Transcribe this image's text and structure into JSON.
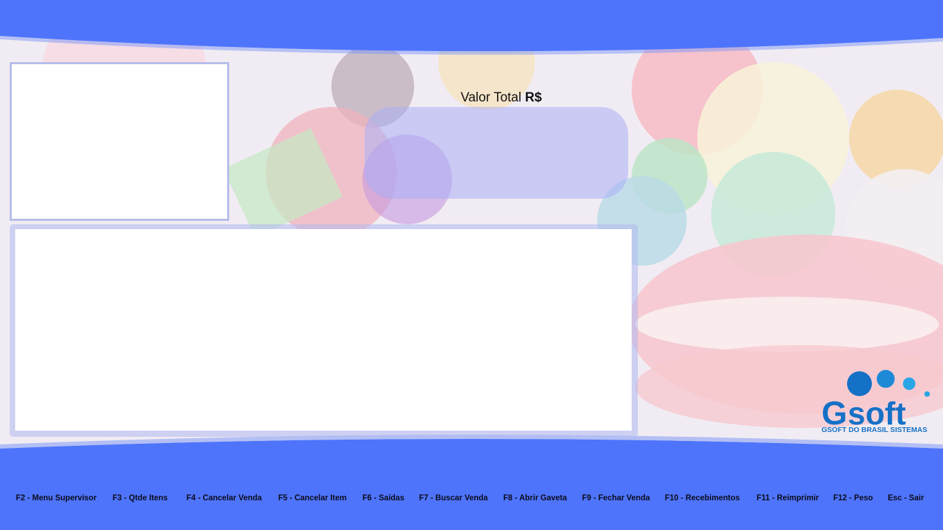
{
  "colors": {
    "band_blue": "#4e74fc",
    "panel_border": "#b6bde9",
    "logo_blue": "#1571c6"
  },
  "total": {
    "label": "Valor Total",
    "currency": "R$",
    "value": ""
  },
  "logo": {
    "letter_g": "G",
    "word": "soft",
    "subtitle": "GSOFT DO BRASIL SISTEMAS"
  },
  "function_keys": [
    {
      "label": "F2 - Menu Supervisor"
    },
    {
      "label": "F3 - Qtde Itens"
    },
    {
      "label": "F4 - Cancelar Venda"
    },
    {
      "label": "F5 - Cancelar Item"
    },
    {
      "label": "F6 - Saídas"
    },
    {
      "label": "F7 - Buscar Venda"
    },
    {
      "label": "F8 - Abrir Gaveta"
    },
    {
      "label": "F9 - Fechar Venda"
    },
    {
      "label": "F10 - Recebimentos"
    },
    {
      "label": "F11 - Reimprimir"
    },
    {
      "label": "F12 - Peso"
    },
    {
      "label": "Esc - Sair"
    }
  ]
}
